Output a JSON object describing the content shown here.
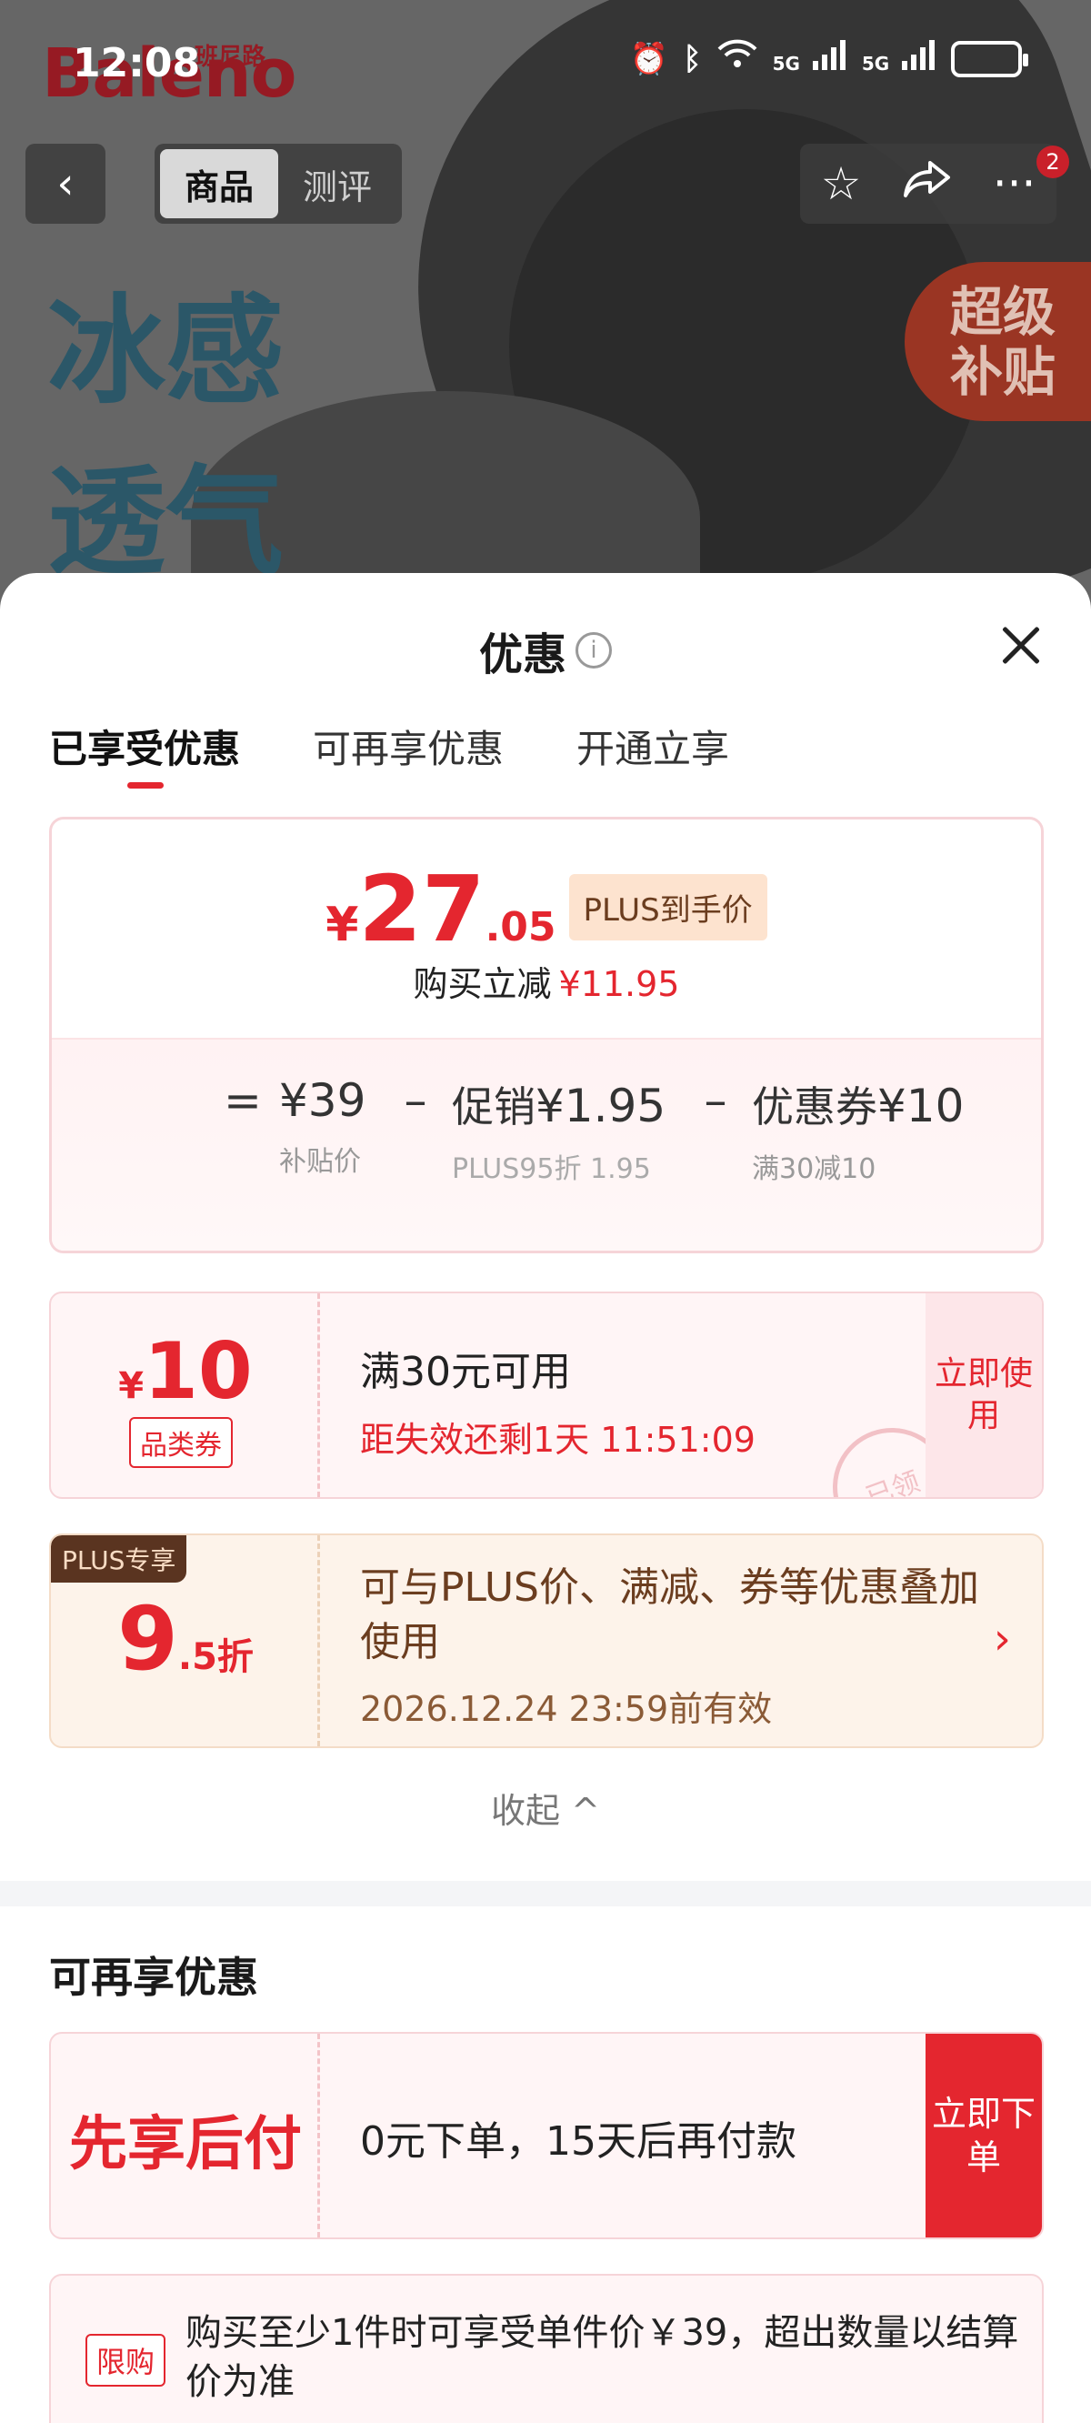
{
  "status_bar": {
    "time": "12:08",
    "network": "5G",
    "icons": [
      "alarm-icon",
      "bluetooth-icon",
      "wifi-icon",
      "signal-icon",
      "signal-icon",
      "battery-icon"
    ]
  },
  "hero": {
    "brand_logo": "Baleno",
    "brand_cn": "班尼路",
    "slogan_line1": "冰感",
    "slogan_line2": "透气",
    "subsidy_line1": "超级",
    "subsidy_line2": "补贴"
  },
  "nav": {
    "tab_product": "商品",
    "tab_review": "测评",
    "more_badge": "2"
  },
  "sheet": {
    "title": "优惠",
    "tabs": [
      "已享受优惠",
      "可再享优惠",
      "开通立享"
    ],
    "price": {
      "currency": "¥",
      "integer": "27",
      "decimal": ".05",
      "tag": "PLUS到手价",
      "instant_cut_label": "购买立减",
      "instant_cut_amount": "¥11.95"
    },
    "breakdown": {
      "equals": "=",
      "minus": "–",
      "base_value": "¥39",
      "base_note": "补贴价",
      "promo_label": "促销",
      "promo_value": "¥1.95",
      "promo_note": "PLUS95折 1.95",
      "coupon_label": "优惠券",
      "coupon_value": "¥10",
      "coupon_note": "满30减10"
    },
    "coupon": {
      "currency": "¥",
      "amount": "10",
      "type": "品类券",
      "condition": "满30元可用",
      "expire": "距失效还剩1天 11:51:09",
      "button": "立即使用",
      "stamp": "已领"
    },
    "plus": {
      "tag": "PLUS专享",
      "discount_big": "9",
      "discount_small": ".5折",
      "description": "可与PLUS价、满减、券等优惠叠加使用",
      "expire": "2026.12.24 23:59前有效"
    },
    "collapse": "收起 ^",
    "more_section_title": "可再享优惠",
    "bnpl": {
      "label": "先享后付",
      "description": "0元下单，15天后再付款",
      "button": "立即下单"
    },
    "limit": {
      "tag": "限购",
      "text": "购买至少1件时可享受单件价￥39，超出数量以结算价为准"
    }
  },
  "colors": {
    "accent_red": "#e4262f",
    "plus_brown": "#5a3420"
  }
}
